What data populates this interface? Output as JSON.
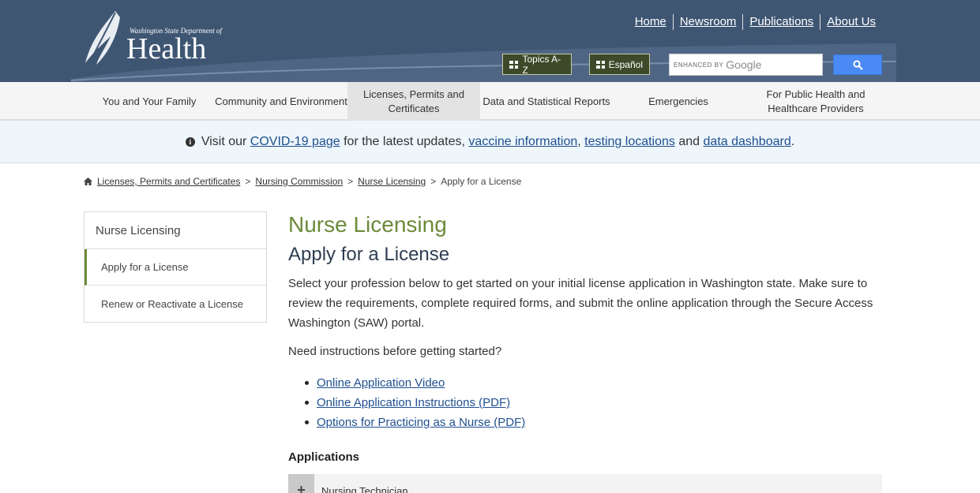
{
  "logo": {
    "dept_text": "Washington State Department of",
    "health_text": "Health"
  },
  "utility_nav": [
    {
      "label": "Home"
    },
    {
      "label": "Newsroom"
    },
    {
      "label": "Publications"
    },
    {
      "label": "About Us"
    }
  ],
  "buttons": {
    "topics": "Topics A-Z",
    "espanol": "Español"
  },
  "search": {
    "enhanced_by": "ENHANCED BY",
    "google": "Google",
    "icon": "search-icon"
  },
  "main_nav": [
    {
      "label": "You and Your Family"
    },
    {
      "label": "Community and Environment"
    },
    {
      "label": "Licenses, Permits and Certificates",
      "active": true
    },
    {
      "label": "Data and Statistical Reports"
    },
    {
      "label": "Emergencies"
    },
    {
      "label": "For Public Health and Healthcare Providers"
    }
  ],
  "covid_banner": {
    "prefix": "Visit our",
    "link1": "COVID-19 page",
    "middle": "for the latest updates,",
    "link2": "vaccine information",
    "comma": ",",
    "link3": "testing locations",
    "and": "and",
    "link4": "data dashboard",
    "period": "."
  },
  "breadcrumb": [
    {
      "label": "Licenses, Permits and Certificates"
    },
    {
      "label": "Nursing Commission"
    },
    {
      "label": "Nurse Licensing"
    }
  ],
  "breadcrumb_current": "Apply for a License",
  "breadcrumb_separator": ">",
  "sidebar": {
    "title": "Nurse Licensing",
    "items": [
      {
        "label": "Apply for a License",
        "active": true
      },
      {
        "label": "Renew or Reactivate a License"
      }
    ]
  },
  "content": {
    "title": "Nurse Licensing",
    "subtitle": "Apply for a License",
    "intro": "Select your profession below to get started on your initial license application in Washington state. Make sure to review the requirements, complete required forms, and submit the online application through the Secure Access Washington (SAW) portal.",
    "need": "Need instructions before getting started?",
    "links": [
      {
        "label": "Online Application Video"
      },
      {
        "label": "Online Application Instructions (PDF)"
      },
      {
        "label": "Options for Practicing as a Nurse (PDF)"
      }
    ],
    "applications_heading": "Applications",
    "accordion": {
      "plus": "+",
      "label": "Nursing Technician"
    }
  },
  "colors": {
    "header_bg": "#3f5673",
    "title_green": "#6b8a3a",
    "link_blue": "#1f4f8f",
    "search_button": "#4a8af4"
  }
}
